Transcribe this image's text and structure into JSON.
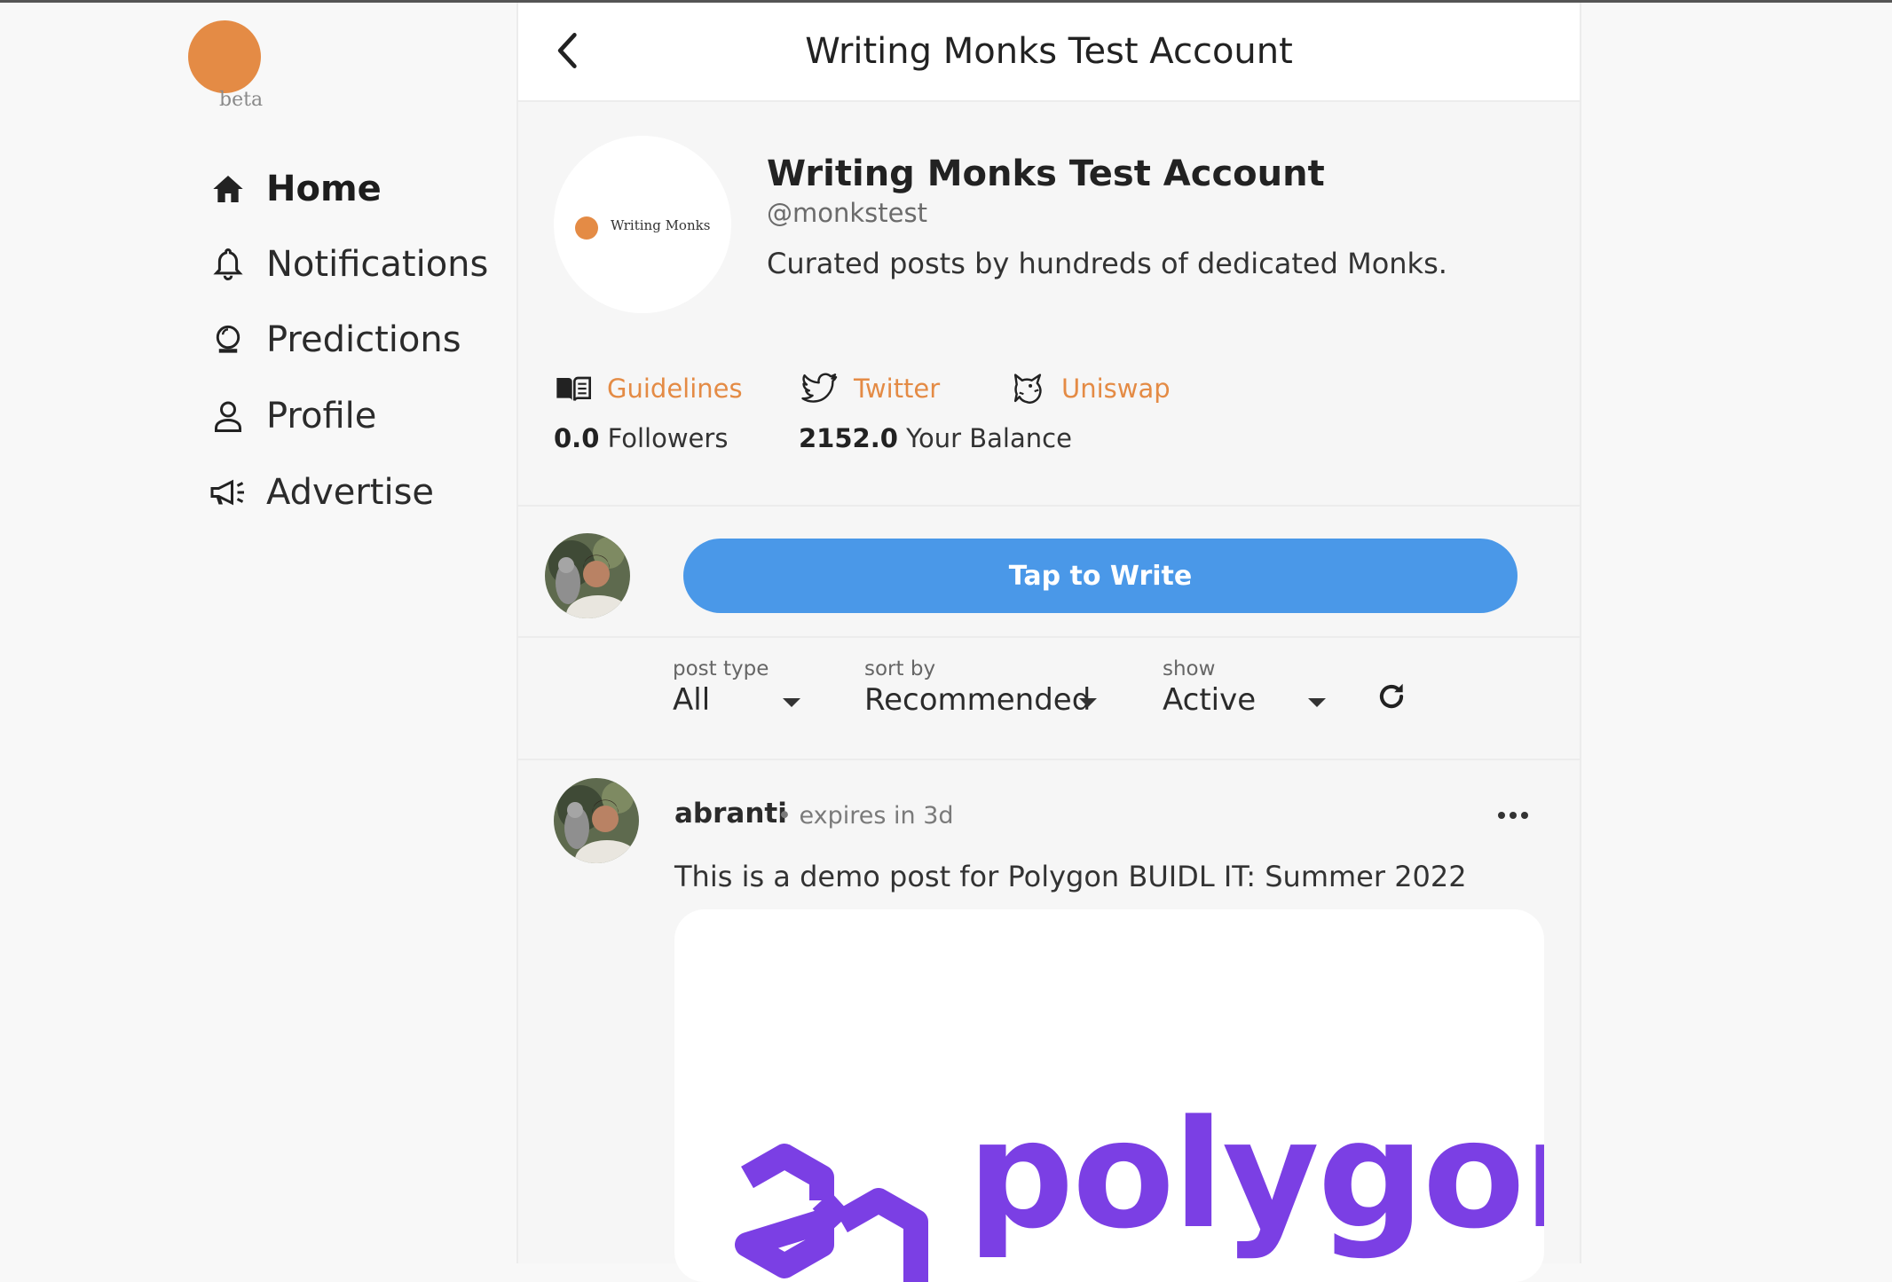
{
  "app": {
    "logo_badge": "beta",
    "logo_color": "#e48b45"
  },
  "sidebar": {
    "items": [
      {
        "label": "Home",
        "icon": "home-icon",
        "active": true
      },
      {
        "label": "Notifications",
        "icon": "bell-icon"
      },
      {
        "label": "Predictions",
        "icon": "crystal-ball-icon"
      },
      {
        "label": "Profile",
        "icon": "user-icon"
      },
      {
        "label": "Advertise",
        "icon": "megaphone-icon"
      }
    ]
  },
  "header": {
    "title": "Writing Monks Test Account",
    "back_icon": "chevron-left-icon"
  },
  "profile": {
    "avatar_text": "Writing Monks",
    "name": "Writing Monks Test Account",
    "handle": "@monkstest",
    "bio": "Curated posts by hundreds of dedicated Monks.",
    "links": [
      {
        "label": "Guidelines",
        "icon": "book-icon"
      },
      {
        "label": "Twitter",
        "icon": "twitter-icon"
      },
      {
        "label": "Uniswap",
        "icon": "unicorn-icon"
      }
    ],
    "stats": {
      "followers_value": "0.0",
      "followers_label": "Followers",
      "balance_value": "2152.0",
      "balance_label": "Your Balance"
    }
  },
  "composer": {
    "button_label": "Tap to Write",
    "button_color": "#4a98e8"
  },
  "filters": [
    {
      "label": "post type",
      "value": "All"
    },
    {
      "label": "sort by",
      "value": "Recommended"
    },
    {
      "label": "show",
      "value": "Active"
    }
  ],
  "post": {
    "author": "abranti",
    "meta": "• expires in 3d",
    "text": "This is a demo post for Polygon BUIDL IT: Summer 2022",
    "image_text": "polygon",
    "image_color": "#7b3fe4"
  },
  "colors": {
    "accent": "#e48b45",
    "primary_button": "#4a98e8",
    "brand_purple": "#7b3fe4"
  }
}
